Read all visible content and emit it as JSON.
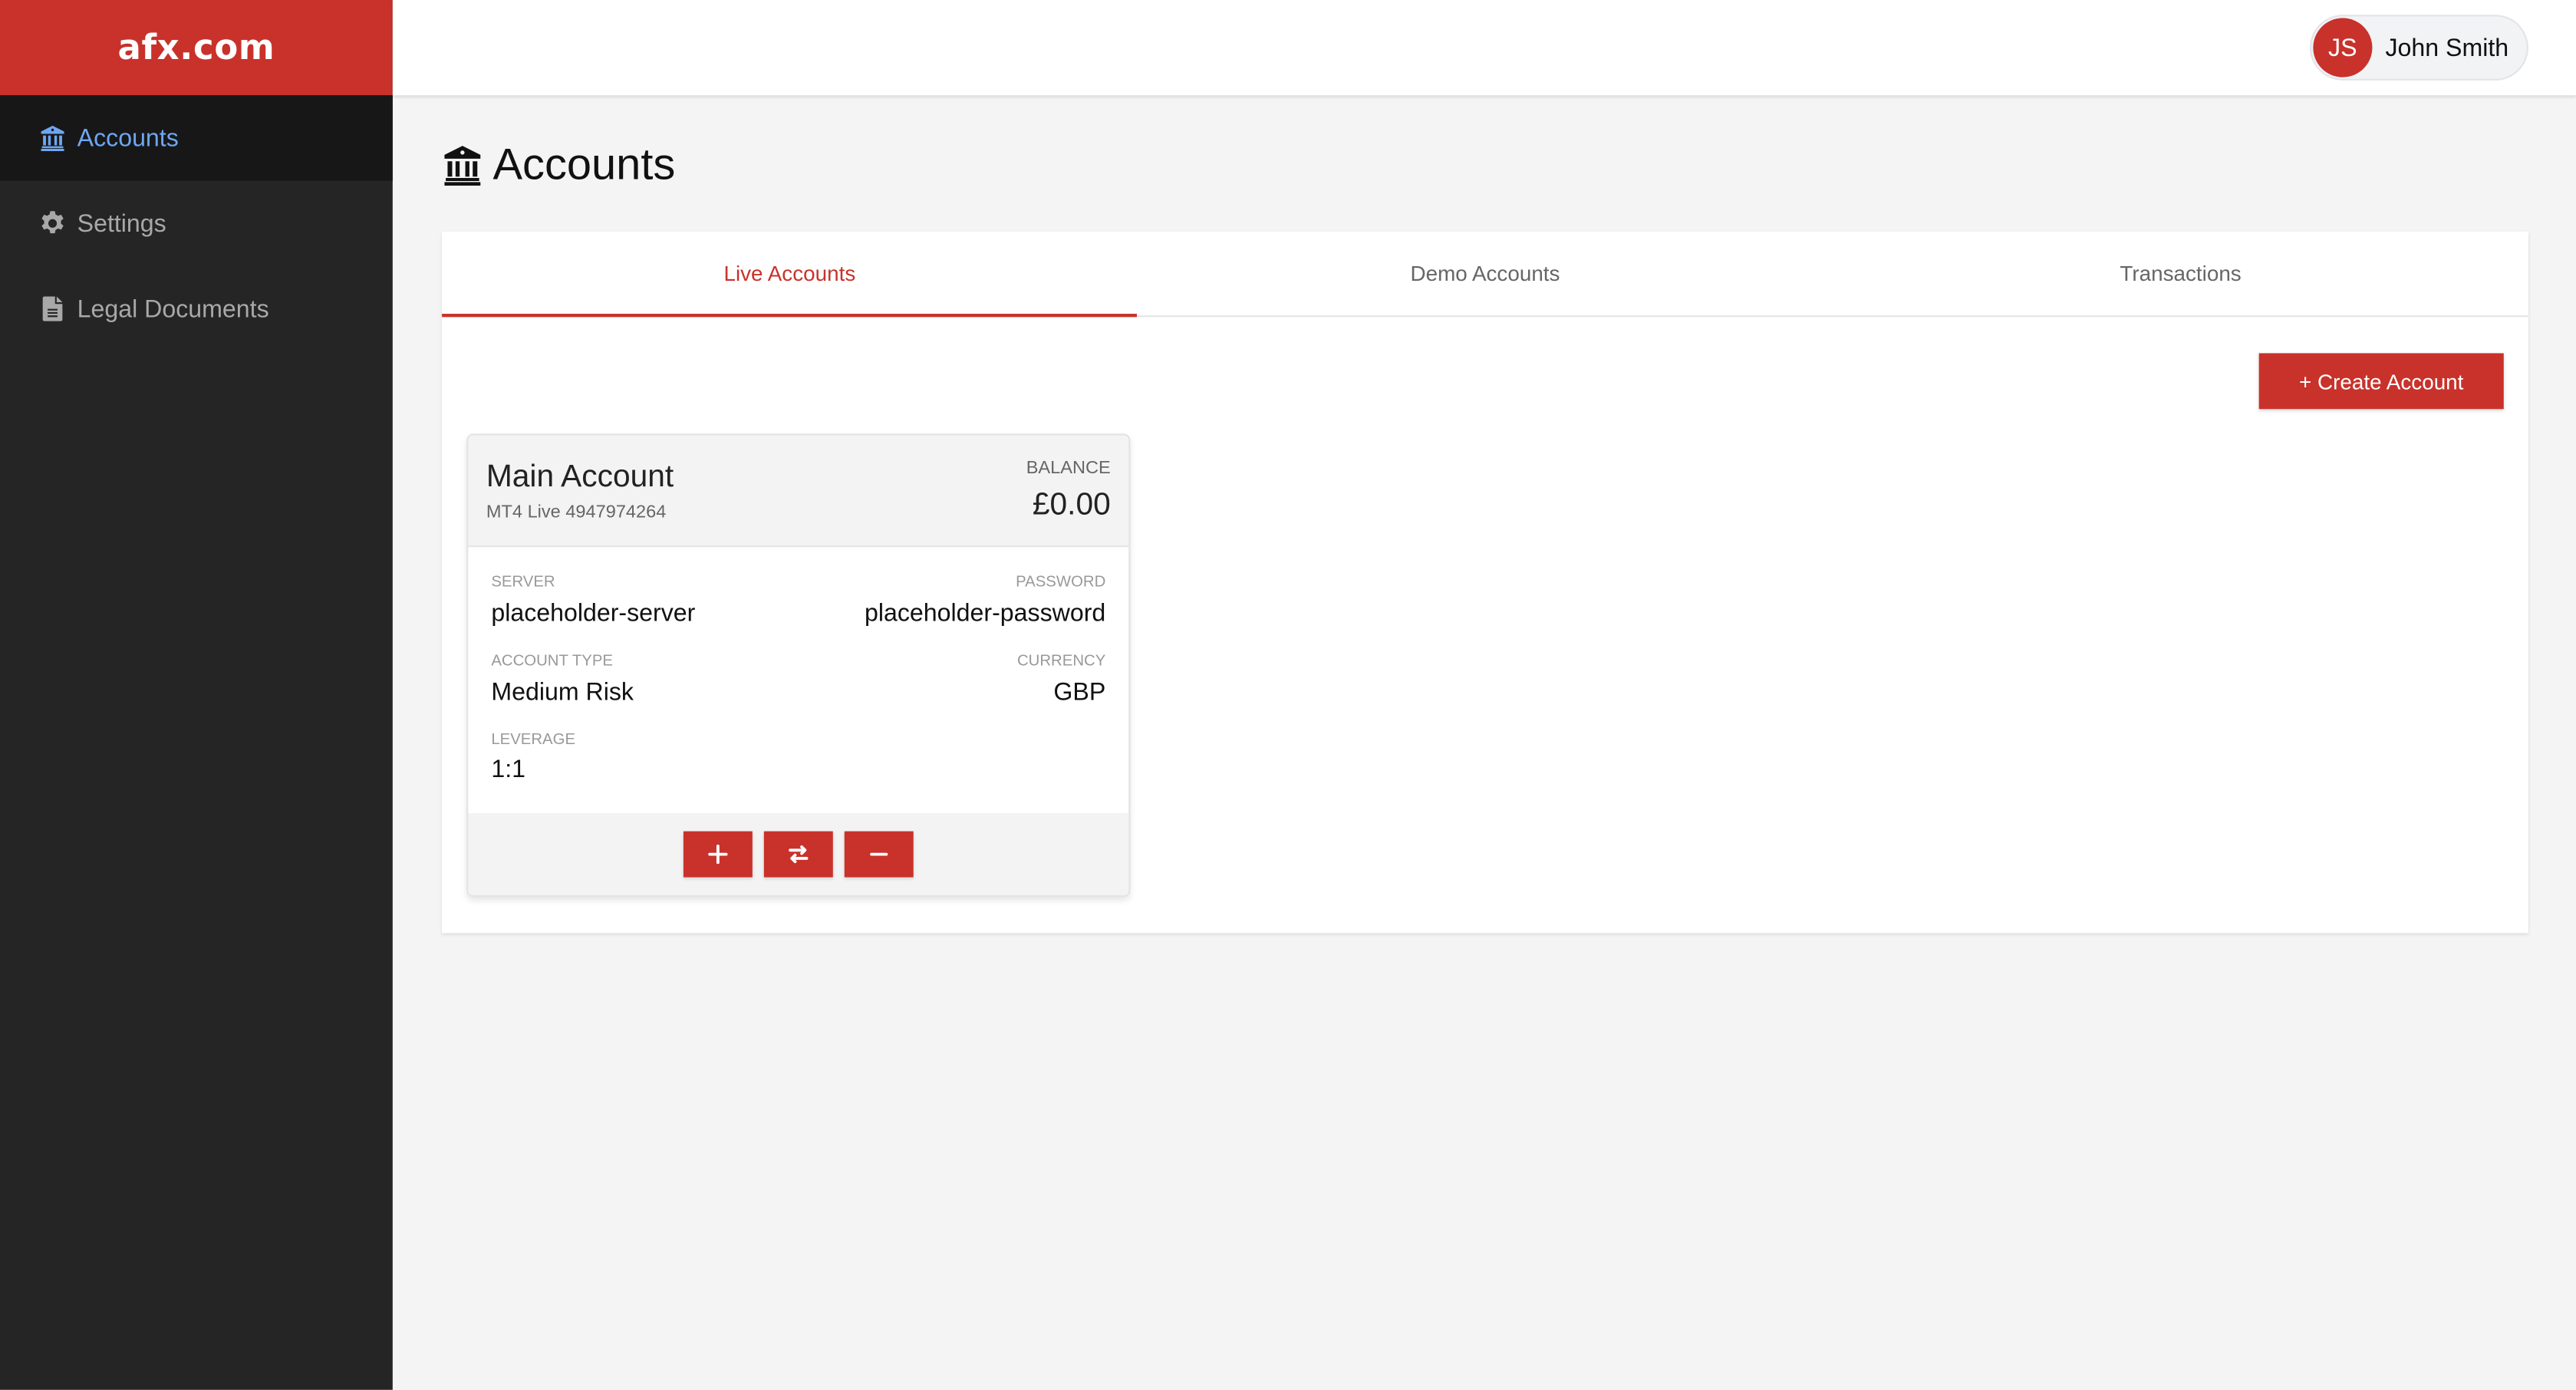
{
  "brand": {
    "logo_text": "afx.com",
    "color": "#c8322b"
  },
  "sidebar": {
    "items": [
      {
        "label": "Accounts",
        "icon": "bank-icon",
        "active": true
      },
      {
        "label": "Settings",
        "icon": "gear-icon",
        "active": false
      },
      {
        "label": "Legal Documents",
        "icon": "document-icon",
        "active": false
      }
    ]
  },
  "header": {
    "user": {
      "initials": "JS",
      "name": "John Smith"
    }
  },
  "main": {
    "title": "Accounts",
    "tabs": [
      {
        "label": "Live Accounts",
        "active": true
      },
      {
        "label": "Demo Accounts",
        "active": false
      },
      {
        "label": "Transactions",
        "active": false
      }
    ],
    "create_button": "+ Create Account",
    "accounts": [
      {
        "name": "Main Account",
        "subtitle": "MT4 Live 4947974264",
        "balance_label": "BALANCE",
        "balance": "£0.00",
        "fields": {
          "server_label": "SERVER",
          "server": "placeholder-server",
          "password_label": "PASSWORD",
          "password": "placeholder-password",
          "account_type_label": "ACCOUNT TYPE",
          "account_type": "Medium Risk",
          "currency_label": "CURRENCY",
          "currency": "GBP",
          "leverage_label": "LEVERAGE",
          "leverage": "1:1"
        },
        "actions": [
          {
            "name": "deposit",
            "icon": "plus-icon"
          },
          {
            "name": "transfer",
            "icon": "swap-arrows-icon"
          },
          {
            "name": "withdraw",
            "icon": "minus-icon"
          }
        ]
      }
    ]
  }
}
